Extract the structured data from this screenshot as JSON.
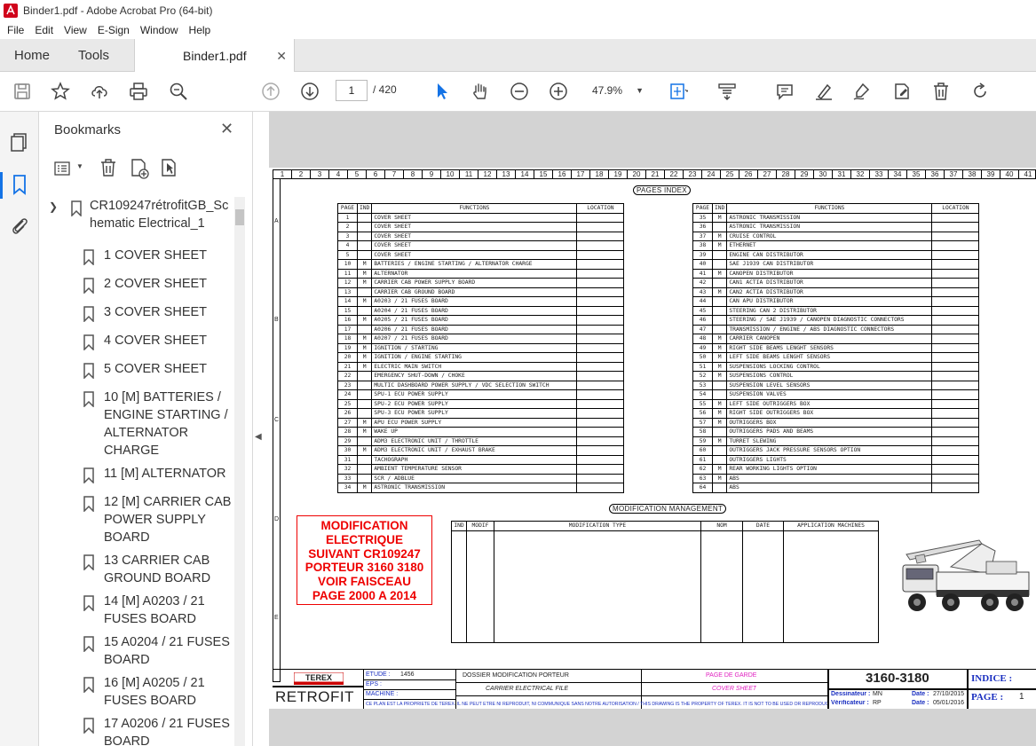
{
  "window": {
    "title": "Binder1.pdf - Adobe Acrobat Pro (64-bit)"
  },
  "menu": [
    "File",
    "Edit",
    "View",
    "E-Sign",
    "Window",
    "Help"
  ],
  "tabs": {
    "home": "Home",
    "tools": "Tools",
    "document": "Binder1.pdf"
  },
  "toolbar": {
    "page_current": "1",
    "page_total": "/ 420",
    "zoom": "47.9%"
  },
  "bookmarks": {
    "header": "Bookmarks",
    "root": "CR109247rétrofitGB_Schematic Electrical_1",
    "items": [
      "1 COVER SHEET",
      "2 COVER SHEET",
      "3 COVER SHEET",
      "4 COVER SHEET",
      "5 COVER SHEET",
      "10 [M] BATTERIES / ENGINE STARTING / ALTERNATOR CHARGE",
      "11 [M] ALTERNATOR",
      "12 [M] CARRIER CAB POWER SUPPLY BOARD",
      "13 CARRIER CAB GROUND BOARD",
      "14 [M] A0203 / 21 FUSES BOARD",
      "15 A0204 / 21 FUSES BOARD",
      "16 [M] A0205 / 21 FUSES BOARD",
      "17 A0206 / 21 FUSES BOARD"
    ]
  },
  "drawing": {
    "ruler_cols": [
      "1",
      "2",
      "3",
      "4",
      "5",
      "6",
      "7",
      "8",
      "9",
      "10",
      "11",
      "12",
      "13",
      "14",
      "15",
      "16",
      "17",
      "18",
      "19",
      "20",
      "21",
      "22",
      "23",
      "24",
      "25",
      "26",
      "27",
      "28",
      "29",
      "30",
      "31",
      "32",
      "33",
      "34",
      "35",
      "36",
      "37",
      "38",
      "39",
      "40",
      "41"
    ],
    "row_letters": [
      "A",
      "B",
      "C",
      "D",
      "E"
    ],
    "pages_index_title": "PAGES INDEX",
    "index_headers": {
      "page": "PAGE",
      "ind": "IND",
      "functions": "FUNCTIONS",
      "location": "LOCATION"
    },
    "index_left": [
      [
        "1",
        "",
        "COVER SHEET"
      ],
      [
        "2",
        "",
        "COVER SHEET"
      ],
      [
        "3",
        "",
        "COVER SHEET"
      ],
      [
        "4",
        "",
        "COVER SHEET"
      ],
      [
        "5",
        "",
        "COVER SHEET"
      ],
      [
        "10",
        "M",
        "BATTERIES / ENGINE STARTING / ALTERNATOR CHARGE"
      ],
      [
        "11",
        "M",
        "ALTERNATOR"
      ],
      [
        "12",
        "M",
        "CARRIER CAB POWER SUPPLY BOARD"
      ],
      [
        "13",
        "",
        "CARRIER CAB GROUND BOARD"
      ],
      [
        "14",
        "M",
        "A0203 / 21 FUSES BOARD"
      ],
      [
        "15",
        "",
        "A0204 / 21 FUSES BOARD"
      ],
      [
        "16",
        "M",
        "A0205 / 21 FUSES BOARD"
      ],
      [
        "17",
        "",
        "A0206 / 21 FUSES BOARD"
      ],
      [
        "18",
        "M",
        "A0207 / 21 FUSES BOARD"
      ],
      [
        "19",
        "M",
        "IGNITION / STARTING"
      ],
      [
        "20",
        "M",
        "IGNITION / ENGINE STARTING"
      ],
      [
        "21",
        "M",
        "ELECTRIC MAIN SWITCH"
      ],
      [
        "22",
        "",
        "EMERGENCY SHUT-DOWN / CHOKE"
      ],
      [
        "23",
        "",
        "MULTIC DASHBOARD POWER SUPPLY / VDC SELECTION SWITCH"
      ],
      [
        "24",
        "",
        "SPU-1 ECU POWER SUPPLY"
      ],
      [
        "25",
        "",
        "SPU-2 ECU POWER SUPPLY"
      ],
      [
        "26",
        "",
        "SPU-3 ECU POWER SUPPLY"
      ],
      [
        "27",
        "M",
        "APU ECU POWER SUPPLY"
      ],
      [
        "28",
        "M",
        "WAKE UP"
      ],
      [
        "29",
        "",
        "ADM3 ELECTRONIC UNIT / THROTTLE"
      ],
      [
        "30",
        "M",
        "ADM3 ELECTRONIC UNIT / EXHAUST BRAKE"
      ],
      [
        "31",
        "",
        "TACHOGRAPH"
      ],
      [
        "32",
        "",
        "AMBIENT TEMPERATURE SENSOR"
      ],
      [
        "33",
        "",
        "SCR / ADBLUE"
      ],
      [
        "34",
        "M",
        "ASTRONIC TRANSMISSION"
      ]
    ],
    "index_right": [
      [
        "35",
        "M",
        "ASTRONIC TRANSMISSION"
      ],
      [
        "36",
        "",
        "ASTRONIC TRANSMISSION"
      ],
      [
        "37",
        "M",
        "CRUISE CONTROL"
      ],
      [
        "38",
        "M",
        "ETHERNET"
      ],
      [
        "39",
        "",
        "ENGINE CAN DISTRIBUTOR"
      ],
      [
        "40",
        "",
        "SAE J1939 CAN DISTRIBUTOR"
      ],
      [
        "41",
        "M",
        "CANOPEN DISTRIBUTOR"
      ],
      [
        "42",
        "",
        "CAN1 ACTIA DISTRIBUTOR"
      ],
      [
        "43",
        "M",
        "CAN2 ACTIA DISTRIBUTOR"
      ],
      [
        "44",
        "",
        "CAN APU DISTRIBUTOR"
      ],
      [
        "45",
        "",
        "STEERING CAN 2 DISTRIBUTOR"
      ],
      [
        "46",
        "",
        "STEERING / SAE J1939 / CANOPEN DIAGNOSTIC CONNECTORS"
      ],
      [
        "47",
        "",
        "TRANSMISSION / ENGINE / ABS DIAGNOSTIC CONNECTORS"
      ],
      [
        "48",
        "M",
        "CARRIER CANOPEN"
      ],
      [
        "49",
        "M",
        "RIGHT SIDE BEAMS LENGHT SENSORS"
      ],
      [
        "50",
        "M",
        "LEFT SIDE BEAMS LENGHT SENSORS"
      ],
      [
        "51",
        "M",
        "SUSPENSIONS LOCKING CONTROL"
      ],
      [
        "52",
        "M",
        "SUSPENSIONS CONTROL"
      ],
      [
        "53",
        "",
        "SUSPENSION LEVEL SENSORS"
      ],
      [
        "54",
        "",
        "SUSPENSION VALVES"
      ],
      [
        "55",
        "M",
        "LEFT SIDE OUTRIGGERS BOX"
      ],
      [
        "56",
        "M",
        "RIGHT SIDE OUTRIGGERS BOX"
      ],
      [
        "57",
        "M",
        "OUTRIGGERS BOX"
      ],
      [
        "58",
        "",
        "OUTRIGGERS PADS AND BEAMS"
      ],
      [
        "59",
        "M",
        "TURRET SLEWING"
      ],
      [
        "60",
        "",
        "OUTRIGGERS JACK PRESSURE SENSORS OPTION"
      ],
      [
        "61",
        "",
        "OUTRIGGERS LIGHTS"
      ],
      [
        "62",
        "M",
        "REAR WORKING LIGHTS OPTION"
      ],
      [
        "63",
        "M",
        "ABS"
      ],
      [
        "64",
        "",
        "ABS"
      ]
    ],
    "modif_title": "MODIFICATION MANAGEMENT",
    "modif_headers": [
      "IND",
      "MODIF",
      "MODIFICATION TYPE",
      "NOM",
      "DATE",
      "APPLICATION MACHINES"
    ],
    "red_note": [
      "MODIFICATION",
      "ELECTRIQUE",
      "SUIVANT CR109247",
      "PORTEUR 3160 3180",
      "VOIR FAISCEAU",
      "PAGE 2000 A 2014"
    ],
    "title_block": {
      "logo": "TEREX",
      "retrofit": "RETROFIT",
      "etude_label": "ETUDE :",
      "etude_value": "1456",
      "eps_label": "EPS :",
      "machine_label": "MACHINE :",
      "dossier": "DOSSIER MODIFICATION PORTEUR",
      "file": "CARRIER ELECTRICAL FILE",
      "page_de_garde": "PAGE DE GARDE",
      "cover_sheet": "COVER SHEET",
      "number": "3160-3180",
      "dessinateur_label": "Dessinateur :",
      "dessinateur_value": "MN",
      "verificateur_label": "Vérificateur :",
      "verificateur_value": "RP",
      "date_label": "Date :",
      "date1": "27/10/2015",
      "date2": "05/01/2016",
      "indice_label": "INDICE :",
      "page_label": "PAGE :",
      "page_value": "1",
      "disclaimer": "CE PLAN EST LA PROPRIETE DE TEREX. IL NE PEUT ETRE NI REPRODUIT, NI COMMUNIQUE SANS NOTRE AUTORISATION / THIS DRAWING IS THE PROPERTY OF TEREX. IT IS NOT TO BE USED OR REPRODUCED WITHOUT OUR AUTHORISATION"
    }
  }
}
